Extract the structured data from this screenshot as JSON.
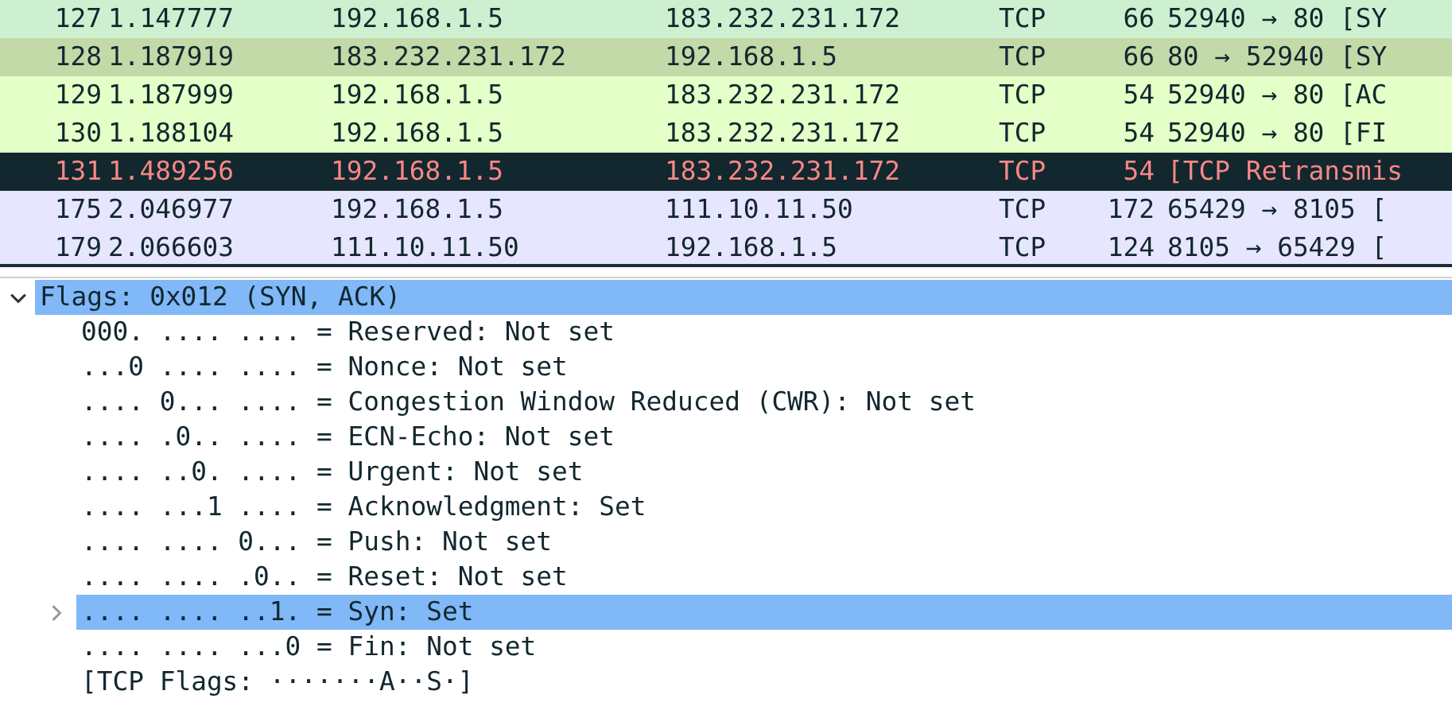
{
  "packet_list": {
    "rows": [
      {
        "no": "127",
        "time": "1.147777",
        "source": "192.168.1.5",
        "destination": "183.232.231.172",
        "protocol": "TCP",
        "length": "66",
        "info": "52940 → 80 [SY",
        "color": "#cdf0d0",
        "kind": "normal"
      },
      {
        "no": "128",
        "time": "1.187919",
        "source": "183.232.231.172",
        "destination": "192.168.1.5",
        "protocol": "TCP",
        "length": "66",
        "info": "80 → 52940 [SY",
        "color": "#c3d9a8",
        "kind": "normal"
      },
      {
        "no": "129",
        "time": "1.187999",
        "source": "192.168.1.5",
        "destination": "183.232.231.172",
        "protocol": "TCP",
        "length": "54",
        "info": "52940 → 80 [AC",
        "color": "#e4ffc7",
        "kind": "normal"
      },
      {
        "no": "130",
        "time": "1.188104",
        "source": "192.168.1.5",
        "destination": "183.232.231.172",
        "protocol": "TCP",
        "length": "54",
        "info": "52940 → 80 [FI",
        "color": "#e4ffc7",
        "kind": "normal"
      },
      {
        "no": "131",
        "time": "1.489256",
        "source": "192.168.1.5",
        "destination": "183.232.231.172",
        "protocol": "TCP",
        "length": "54",
        "info": "[TCP Retransmis",
        "color": "#12272e",
        "kind": "error"
      },
      {
        "no": "175",
        "time": "2.046977",
        "source": "192.168.1.5",
        "destination": "111.10.11.50",
        "protocol": "TCP",
        "length": "172",
        "info": "65429 → 8105 [",
        "color": "#e7e6ff",
        "kind": "normal"
      },
      {
        "no": "179",
        "time": "2.066603",
        "source": "111.10.11.50",
        "destination": "192.168.1.5",
        "protocol": "TCP",
        "length": "124",
        "info": "8105 → 65429 [",
        "color": "#e7e6ff",
        "kind": "normal"
      }
    ]
  },
  "details": {
    "items": [
      {
        "text": "Flags: 0x012 (SYN, ACK)",
        "selected": true,
        "expanded": true,
        "children": [
          {
            "text": "000. .... .... = Reserved: Not set",
            "selected": false
          },
          {
            "text": "...0 .... .... = Nonce: Not set",
            "selected": false
          },
          {
            "text": ".... 0... .... = Congestion Window Reduced (CWR): Not set",
            "selected": false
          },
          {
            "text": ".... .0.. .... = ECN-Echo: Not set",
            "selected": false
          },
          {
            "text": ".... ..0. .... = Urgent: Not set",
            "selected": false
          },
          {
            "text": ".... ...1 .... = Acknowledgment: Set",
            "selected": false
          },
          {
            "text": ".... .... 0... = Push: Not set",
            "selected": false
          },
          {
            "text": ".... .... .0.. = Reset: Not set",
            "selected": false
          },
          {
            "text": ".... .... ..1. = Syn: Set",
            "selected": true,
            "expanded": false
          },
          {
            "text": ".... .... ...0 = Fin: Not set",
            "selected": false
          },
          {
            "text": "[TCP Flags: ·······A··S·]",
            "selected": false
          }
        ]
      }
    ]
  }
}
